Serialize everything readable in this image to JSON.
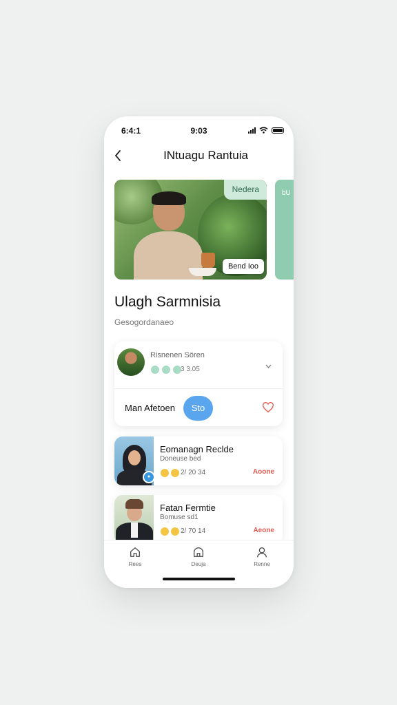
{
  "status": {
    "left_text": "6:4:1",
    "time": "9:03"
  },
  "header": {
    "title": "INtuagu Rantuia",
    "back_icon": "chevron-left-icon"
  },
  "hero": {
    "tag_top": "Nedera",
    "tag_bottom": "Bend Ioo",
    "peek_label": "bU"
  },
  "section": {
    "heading": "Ulagh Sarmnisia",
    "subheading": "Gesogordanaeo"
  },
  "card": {
    "name": "Risnenen Sören",
    "meta": "3 3.05",
    "action_label": "Man Afetoen",
    "pill_label": "Sto"
  },
  "list": [
    {
      "title": "Eomanagn Reclde",
      "subtitle": "Doneuse bed",
      "date": "2/ 20 34",
      "badge": "Aoone"
    },
    {
      "title": "Fatan Fermtie",
      "subtitle": "Bomuse sd1",
      "date": "2/ 70 14",
      "badge": "Aeone"
    }
  ],
  "tabs": [
    {
      "label": "Rees",
      "icon": "home-icon"
    },
    {
      "label": "Deuja",
      "icon": "house-icon"
    },
    {
      "label": "Renne",
      "icon": "user-icon"
    }
  ],
  "colors": {
    "accent": "#5aa6ee",
    "mint": "#cfe9da",
    "badge": "#e35b52"
  }
}
